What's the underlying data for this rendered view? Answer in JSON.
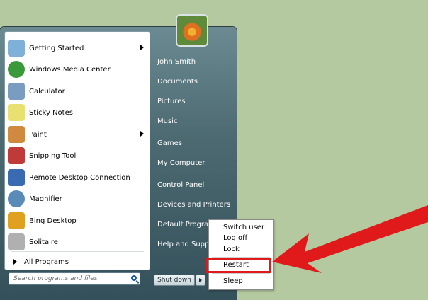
{
  "programs": [
    {
      "label": "Getting Started",
      "icon": "getting-started-icon",
      "has_submenu": true,
      "color": "#7fb0d8"
    },
    {
      "label": "Windows Media Center",
      "icon": "media-center-icon",
      "has_submenu": false,
      "color": "#3a9a3a"
    },
    {
      "label": "Calculator",
      "icon": "calculator-icon",
      "has_submenu": false,
      "color": "#7a9cc0"
    },
    {
      "label": "Sticky Notes",
      "icon": "sticky-notes-icon",
      "has_submenu": false,
      "color": "#e8e070"
    },
    {
      "label": "Paint",
      "icon": "paint-icon",
      "has_submenu": true,
      "color": "#d08a40"
    },
    {
      "label": "Snipping Tool",
      "icon": "snipping-tool-icon",
      "has_submenu": false,
      "color": "#c03a3a"
    },
    {
      "label": "Remote Desktop Connection",
      "icon": "remote-desktop-icon",
      "has_submenu": false,
      "color": "#3a6ab0"
    },
    {
      "label": "Magnifier",
      "icon": "magnifier-icon",
      "has_submenu": false,
      "color": "#5a8ab8"
    },
    {
      "label": "Bing Desktop",
      "icon": "bing-desktop-icon",
      "has_submenu": false,
      "color": "#e0a020"
    },
    {
      "label": "Solitaire",
      "icon": "solitaire-icon",
      "has_submenu": false,
      "color": "#b0b0b0"
    }
  ],
  "all_programs": "All Programs",
  "search_placeholder": "Search programs and files",
  "user_links": [
    "John Smith",
    "Documents",
    "Pictures",
    "Music",
    "Games",
    "My Computer",
    "Control Panel",
    "Devices and Printers",
    "Default Program",
    "Help and Suppor"
  ],
  "shutdown": {
    "label": "Shut down"
  },
  "power_menu": [
    "Switch user",
    "Log off",
    "Lock",
    "Restart",
    "Sleep"
  ],
  "highlight_color": "#e01a1a"
}
